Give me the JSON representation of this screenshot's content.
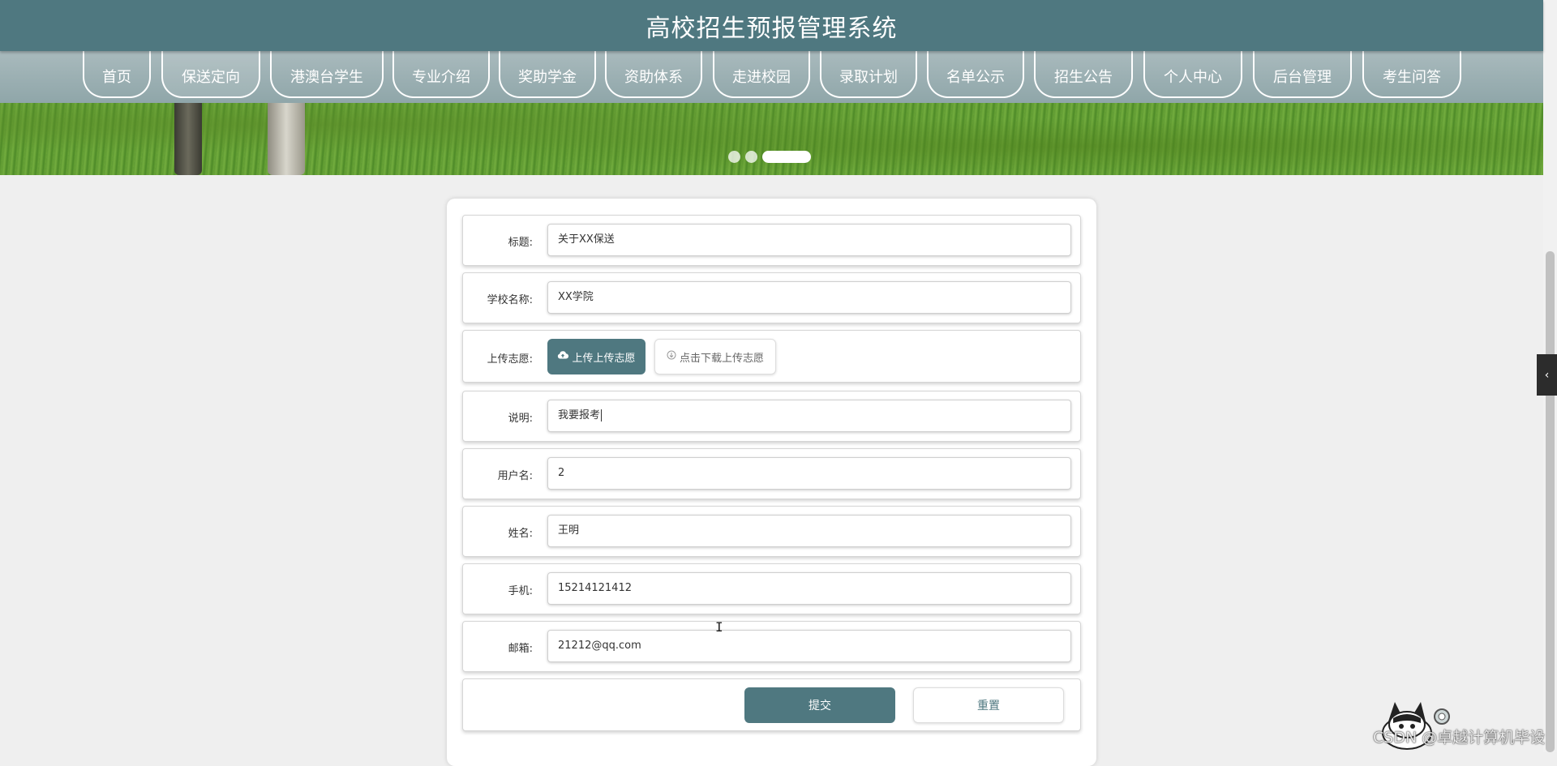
{
  "header": {
    "title": "高校招生预报管理系统"
  },
  "nav": {
    "items": [
      {
        "label": "首页"
      },
      {
        "label": "保送定向"
      },
      {
        "label": "港澳台学生"
      },
      {
        "label": "专业介绍"
      },
      {
        "label": "奖助学金"
      },
      {
        "label": "资助体系"
      },
      {
        "label": "走进校园"
      },
      {
        "label": "录取计划"
      },
      {
        "label": "名单公示"
      },
      {
        "label": "招生公告"
      },
      {
        "label": "个人中心"
      },
      {
        "label": "后台管理"
      },
      {
        "label": "考生问答"
      }
    ],
    "active_index": 1
  },
  "form": {
    "title": {
      "label": "标题:",
      "value": "关于XX保送"
    },
    "school": {
      "label": "学校名称:",
      "value": "XX学院"
    },
    "upload": {
      "label": "上传志愿:",
      "upload_button": "上传上传志愿",
      "download_button": "点击下载上传志愿"
    },
    "description": {
      "label": "说明:",
      "value": "我要报考"
    },
    "username": {
      "label": "用户名:",
      "value": "2"
    },
    "name": {
      "label": "姓名:",
      "value": "王明"
    },
    "phone": {
      "label": "手机:",
      "value": "15214121412"
    },
    "email": {
      "label": "邮箱:",
      "value": "21212@qq.com"
    },
    "submit_button": "提交",
    "reset_button": "重置"
  },
  "watermark": "CSDN @卓越计算机毕设",
  "colors": {
    "primary": "#4f7880",
    "nav_bg": "#9fb2b5",
    "page_bg": "#efefef"
  }
}
